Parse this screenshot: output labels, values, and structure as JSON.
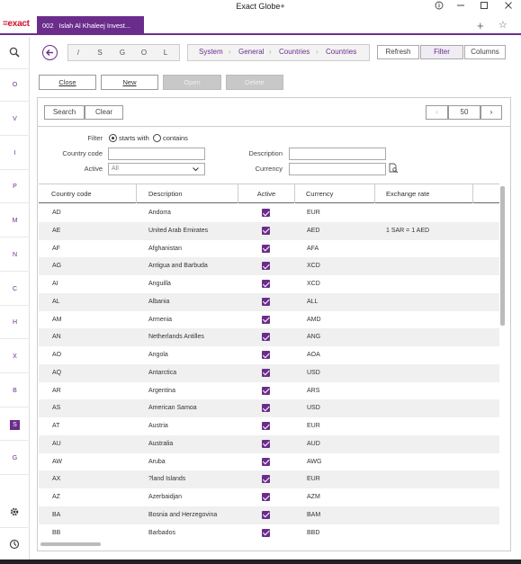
{
  "window": {
    "title": "Exact Globe+",
    "help_icon": "help-icon",
    "minimize_icon": "minimize-icon",
    "maximize_icon": "maximize-icon",
    "close_icon": "close-icon"
  },
  "app": {
    "logo": "=exact",
    "tab_number": "002",
    "tab_label": "Islah Al Khaleej Invest...",
    "accent_color": "#6b2d8c"
  },
  "rail": {
    "letters": [
      "O",
      "V",
      "I",
      "P",
      "M",
      "N",
      "C",
      "H",
      "X",
      "B",
      "S",
      "G"
    ],
    "active_letter": "S"
  },
  "nav": {
    "keys": [
      "/",
      "S",
      "G",
      "O",
      "L"
    ],
    "breadcrumb": [
      "System",
      "General",
      "Countries",
      "Countries"
    ],
    "refresh": "Refresh",
    "filter": "Filter",
    "columns": "Columns"
  },
  "actions": {
    "close": "Close",
    "new": "New",
    "open": "Open",
    "delete": "Delete"
  },
  "search": {
    "search": "Search",
    "clear": "Clear",
    "page_size": "50",
    "prev": "‹",
    "next": "›"
  },
  "filter": {
    "filter_label": "Filter",
    "starts_with": "starts with",
    "contains": "contains",
    "country_code_label": "Country code",
    "country_code_value": "",
    "active_label": "Active",
    "active_value": "All",
    "description_label": "Description",
    "description_value": "",
    "currency_label": "Currency",
    "currency_value": ""
  },
  "grid": {
    "headers": [
      "Country code",
      "Description",
      "Active",
      "Currency",
      "Exchange rate"
    ],
    "rows": [
      {
        "code": "AD",
        "desc": "Andorra",
        "active": true,
        "currency": "EUR",
        "rate": ""
      },
      {
        "code": "AE",
        "desc": "United Arab Emirates",
        "active": true,
        "currency": "AED",
        "rate": "1 SAR = 1 AED"
      },
      {
        "code": "AF",
        "desc": "Afghanistan",
        "active": true,
        "currency": "AFA",
        "rate": ""
      },
      {
        "code": "AG",
        "desc": "Antigua and Barbuda",
        "active": true,
        "currency": "XCD",
        "rate": ""
      },
      {
        "code": "AI",
        "desc": "Anguilla",
        "active": true,
        "currency": "XCD",
        "rate": ""
      },
      {
        "code": "AL",
        "desc": "Albania",
        "active": true,
        "currency": "ALL",
        "rate": ""
      },
      {
        "code": "AM",
        "desc": "Armenia",
        "active": true,
        "currency": "AMD",
        "rate": ""
      },
      {
        "code": "AN",
        "desc": "Netherlands Antilles",
        "active": true,
        "currency": "ANG",
        "rate": ""
      },
      {
        "code": "AO",
        "desc": "Angola",
        "active": true,
        "currency": "AOA",
        "rate": ""
      },
      {
        "code": "AQ",
        "desc": "Antarctica",
        "active": true,
        "currency": "USD",
        "rate": ""
      },
      {
        "code": "AR",
        "desc": "Argentina",
        "active": true,
        "currency": "ARS",
        "rate": ""
      },
      {
        "code": "AS",
        "desc": "American Samoa",
        "active": true,
        "currency": "USD",
        "rate": ""
      },
      {
        "code": "AT",
        "desc": "Austria",
        "active": true,
        "currency": "EUR",
        "rate": ""
      },
      {
        "code": "AU",
        "desc": "Australia",
        "active": true,
        "currency": "AUD",
        "rate": ""
      },
      {
        "code": "AW",
        "desc": "Aruba",
        "active": true,
        "currency": "AWG",
        "rate": ""
      },
      {
        "code": "AX",
        "desc": "?land Islands",
        "active": true,
        "currency": "EUR",
        "rate": ""
      },
      {
        "code": "AZ",
        "desc": "Azerbaidjan",
        "active": true,
        "currency": "AZM",
        "rate": ""
      },
      {
        "code": "BA",
        "desc": "Bosnia and Herzegovina",
        "active": true,
        "currency": "BAM",
        "rate": ""
      },
      {
        "code": "BB",
        "desc": "Barbados",
        "active": true,
        "currency": "BBD",
        "rate": ""
      }
    ]
  }
}
